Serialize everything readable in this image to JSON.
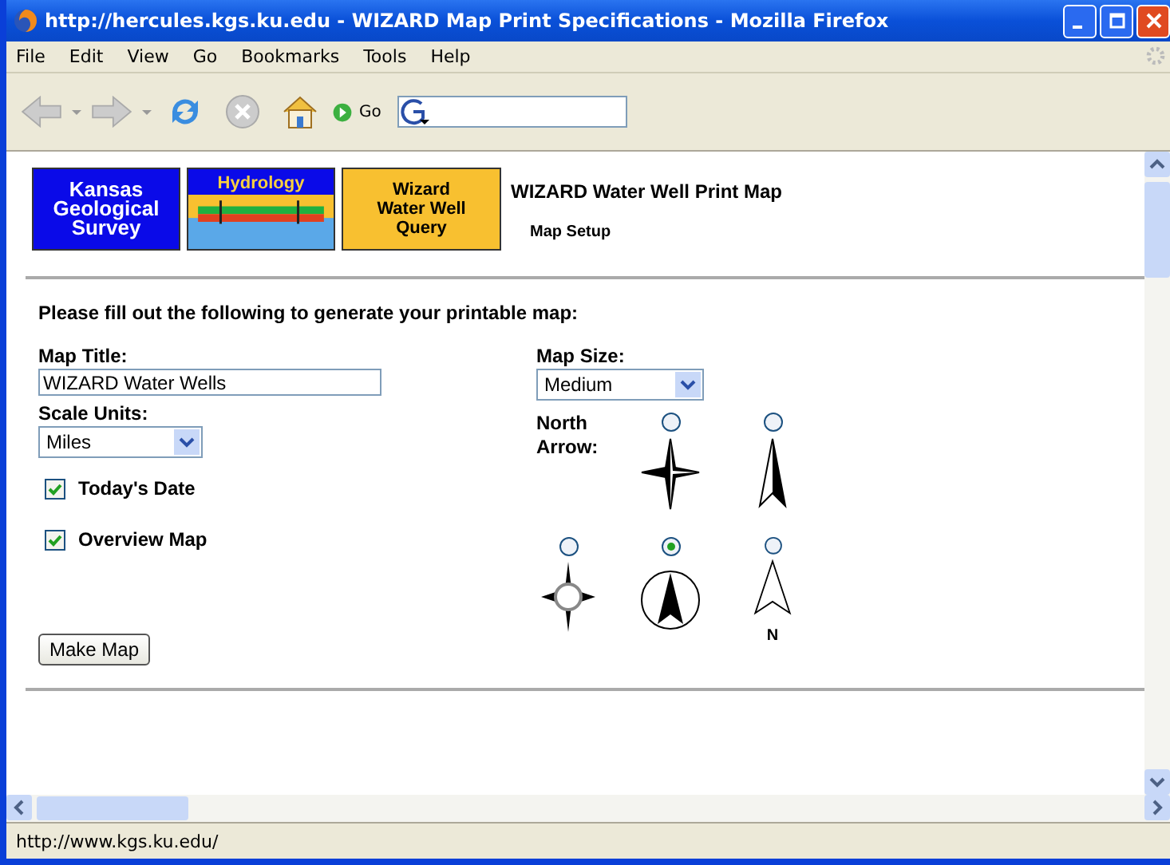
{
  "window": {
    "title": "http://hercules.kgs.ku.edu - WIZARD Map Print Specifications - Mozilla Firefox"
  },
  "menu": [
    "File",
    "Edit",
    "View",
    "Go",
    "Bookmarks",
    "Tools",
    "Help"
  ],
  "toolbar": {
    "go_label": "Go"
  },
  "logos": [
    {
      "kind": "kgs",
      "lines": [
        "Kansas",
        "Geological",
        "Survey"
      ]
    },
    {
      "kind": "hydrology",
      "lines": [
        "Hydrology"
      ]
    },
    {
      "kind": "wizard",
      "lines": [
        "Wizard",
        "Water Well",
        "Query"
      ]
    }
  ],
  "page_title": "WIZARD Water Well Print Map",
  "page_subtitle": "Map Setup",
  "instructions": "Please fill out the following to generate your printable map:",
  "map_title": {
    "label": "Map Title:",
    "value": "WIZARD Water Wells"
  },
  "scale_units": {
    "label": "Scale Units:",
    "value": "Miles"
  },
  "checkboxes": [
    {
      "label": "Today's Date",
      "checked": true
    },
    {
      "label": "Overview Map",
      "checked": true
    }
  ],
  "map_size": {
    "label": "Map Size:",
    "value": "Medium"
  },
  "north_arrow": {
    "label": "North Arrow:",
    "options": [
      {
        "kind": "star",
        "selected": false
      },
      {
        "kind": "half-arrow",
        "selected": false
      },
      {
        "kind": "compass",
        "selected": false
      },
      {
        "kind": "circle-arrow",
        "selected": true
      },
      {
        "kind": "outline-arrow",
        "selected": false,
        "letter": "N"
      }
    ]
  },
  "submit": "Make Map",
  "status_bar": "http://www.kgs.ku.edu/"
}
